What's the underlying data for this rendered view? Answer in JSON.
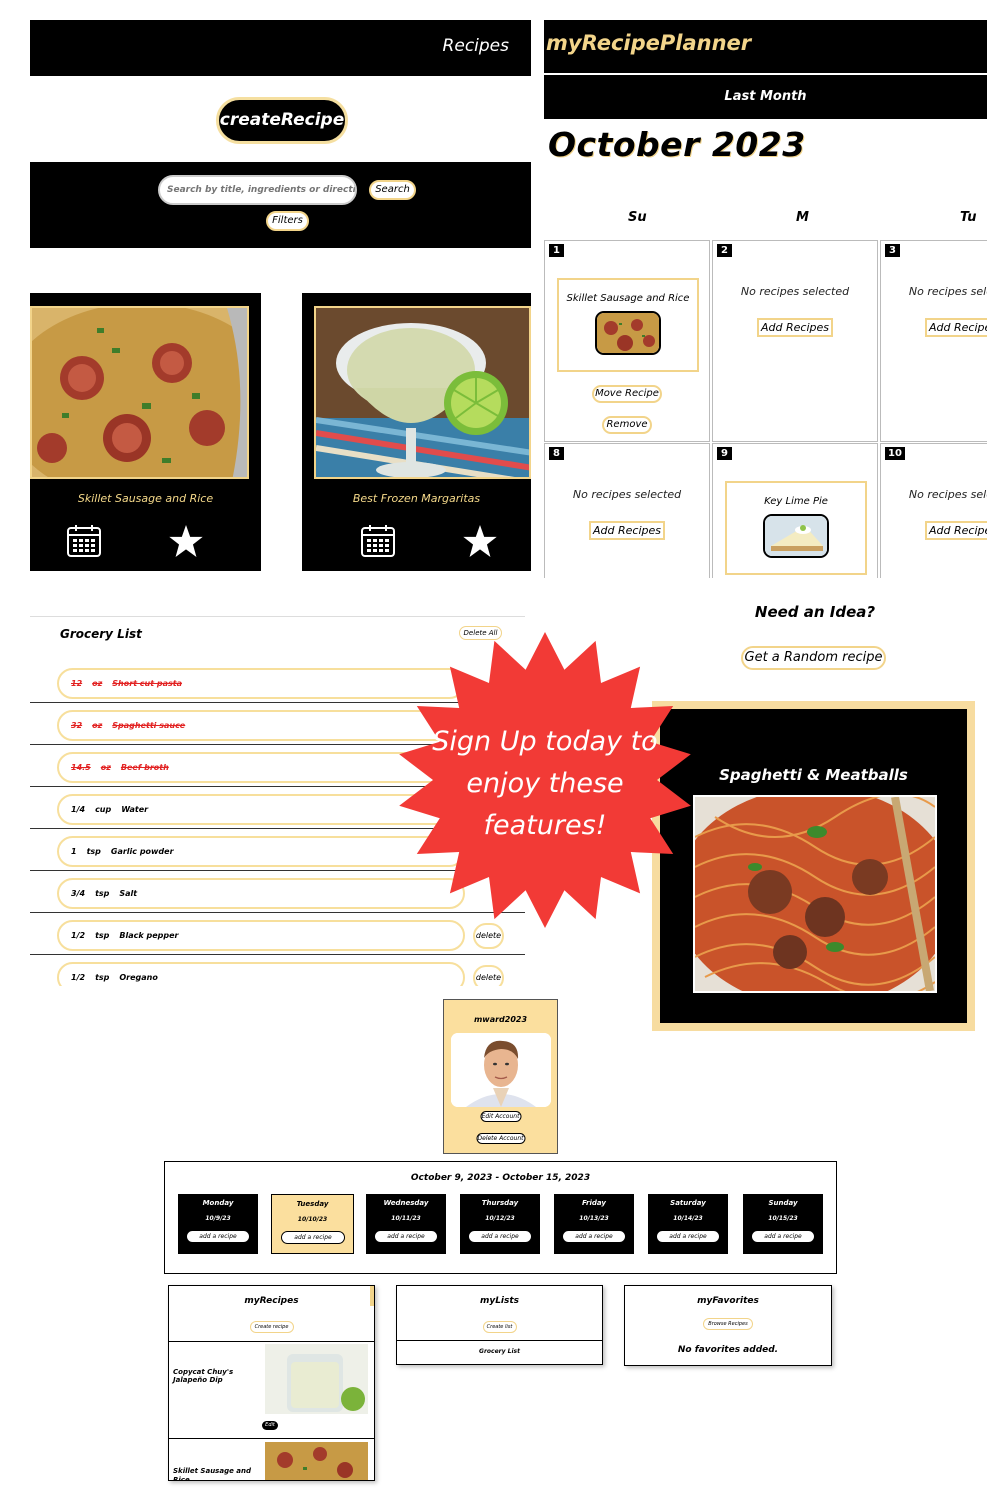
{
  "recipes_page": {
    "header_title": "Recipes",
    "create_label": "createRecipe",
    "search_placeholder": "Search by title, ingredients or directions",
    "search_label": "Search",
    "filters_label": "Filters",
    "cards": [
      {
        "title": "Skillet Sausage and Rice",
        "calendar_icon": "calendar-icon",
        "favorite_icon": "star-icon"
      },
      {
        "title": "Best Frozen Margaritas",
        "calendar_icon": "calendar-icon",
        "favorite_icon": "star-icon"
      }
    ]
  },
  "planner": {
    "app_title": "myRecipePlanner",
    "last_month_label": "Last Month",
    "month_title": "October 2023",
    "weekdays": [
      "Su",
      "M",
      "Tu"
    ],
    "days": [
      {
        "num": "1",
        "recipe": "Skillet Sausage and Rice",
        "move_label": "Move Recipe",
        "remove_label": "Remove"
      },
      {
        "num": "2",
        "empty_text": "No recipes selected",
        "add_label": "Add Recipes"
      },
      {
        "num": "3",
        "empty_text": "No recipes selected",
        "add_label": "Add Recipes"
      },
      {
        "num": "8",
        "empty_text": "No recipes selected",
        "add_label": "Add Recipes"
      },
      {
        "num": "9",
        "recipe": "Key Lime Pie"
      },
      {
        "num": "10",
        "empty_text": "No recipes selected",
        "add_label": "Add Recipes"
      }
    ]
  },
  "idea": {
    "title": "Need an Idea?",
    "random_label": "Get a Random recipe",
    "recipe_title": "Spaghetti & Meatballs"
  },
  "grocery": {
    "title": "Grocery List",
    "delete_all_label": "Delete All",
    "delete_label": "delete",
    "items": [
      {
        "qty": "12",
        "unit": "oz",
        "name": "Short cut pasta",
        "done": true
      },
      {
        "qty": "32",
        "unit": "oz",
        "name": "Spaghetti sauce",
        "done": true
      },
      {
        "qty": "14.5",
        "unit": "oz",
        "name": "Beef broth",
        "done": true
      },
      {
        "qty": "1/4",
        "unit": "cup",
        "name": "Water",
        "done": false
      },
      {
        "qty": "1",
        "unit": "tsp",
        "name": "Garlic powder",
        "done": false
      },
      {
        "qty": "3/4",
        "unit": "tsp",
        "name": "Salt",
        "done": false
      },
      {
        "qty": "1/2",
        "unit": "tsp",
        "name": "Black pepper",
        "done": false
      },
      {
        "qty": "1/2",
        "unit": "tsp",
        "name": "Oregano",
        "done": false
      }
    ]
  },
  "promo": {
    "lines": [
      "Sign Up today to",
      "enjoy these",
      "features!"
    ],
    "color": "#f23a36"
  },
  "account": {
    "username": "mward2023",
    "edit_label": "Edit Account",
    "delete_label": "Delete Account"
  },
  "week": {
    "range": "October 9, 2023 - October 15, 2023",
    "add_label": "add a recipe",
    "days": [
      {
        "name": "Monday",
        "date": "10/9/23",
        "today": false
      },
      {
        "name": "Tuesday",
        "date": "10/10/23",
        "today": true
      },
      {
        "name": "Wednesday",
        "date": "10/11/23",
        "today": false
      },
      {
        "name": "Thursday",
        "date": "10/12/23",
        "today": false
      },
      {
        "name": "Friday",
        "date": "10/13/23",
        "today": false
      },
      {
        "name": "Saturday",
        "date": "10/14/23",
        "today": false
      },
      {
        "name": "Sunday",
        "date": "10/15/23",
        "today": false
      }
    ]
  },
  "my_recipes": {
    "title": "myRecipes",
    "create_label": "Create recipe",
    "edit_label": "Edit",
    "items": [
      "Copycat Chuy's Jalapeño Dip",
      "Skillet Sausage and Rice"
    ]
  },
  "my_lists": {
    "title": "myLists",
    "create_label": "Create list",
    "items": [
      "Grocery List"
    ]
  },
  "my_favorites": {
    "title": "myFavorites",
    "browse_label": "Browse Recipes",
    "empty_text": "No favorites added."
  },
  "colors": {
    "accent_gold": "#f2d48a",
    "panel_black": "#000000",
    "strike_red": "#e22222"
  }
}
